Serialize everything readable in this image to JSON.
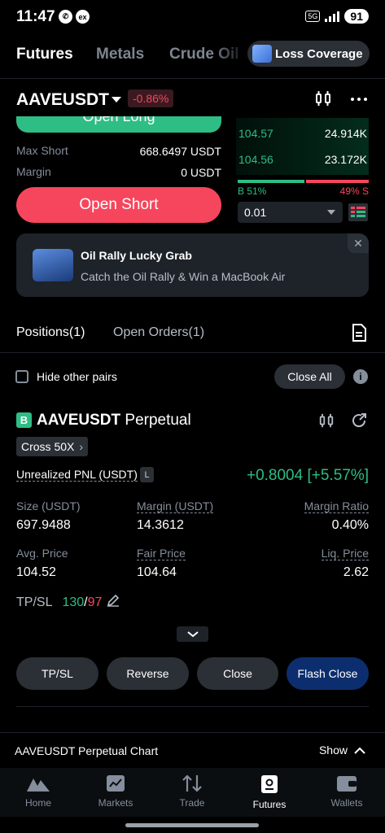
{
  "status_bar": {
    "time": "11:47",
    "network": "5G",
    "battery": "91"
  },
  "top_tabs": {
    "tabs": [
      "Futures",
      "Metals",
      "Crude Oil"
    ],
    "loss_coverage": "Loss Coverage"
  },
  "pair": {
    "symbol": "AAVEUSDT",
    "change": "-0.86%"
  },
  "trade": {
    "open_long_label": "Open Long",
    "max_short_label": "Max Short",
    "max_short_value": "668.6497 USDT",
    "margin_label": "Margin",
    "margin_value": "0 USDT",
    "open_short_label": "Open Short"
  },
  "order_book": {
    "rows": [
      {
        "price": "104.57",
        "qty": "24.914K"
      },
      {
        "price": "104.56",
        "qty": "23.172K"
      }
    ],
    "buy_label": "B 51%",
    "sell_label": "49% S",
    "buy_pct": 51,
    "precision": "0.01"
  },
  "banner": {
    "title": "Oil Rally Lucky Grab",
    "subtitle": "Catch the Oil Rally & Win a MacBook Air",
    "close": "✕"
  },
  "positions_tabs": {
    "positions": "Positions(1)",
    "open_orders": "Open Orders(1)"
  },
  "filter": {
    "hide_other_pairs": "Hide other pairs",
    "close_all": "Close All",
    "info": "i"
  },
  "position": {
    "badge": "B",
    "symbol": "AAVEUSDT",
    "type": "Perpetual",
    "cross": "Cross 50X",
    "cross_arrow": "›",
    "pnl_label": "Unrealized PNL (USDT)",
    "pnl_badge": "L",
    "pnl_value": "+0.8004 [+5.57%]",
    "size_label": "Size (USDT)",
    "size_value": "697.9488",
    "margin_label": "Margin (USDT)",
    "margin_value": "14.3612",
    "margin_ratio_label": "Margin Ratio",
    "margin_ratio_value": "0.40%",
    "avg_price_label": "Avg. Price",
    "avg_price_value": "104.52",
    "fair_price_label": "Fair Price",
    "fair_price_value": "104.64",
    "liq_price_label": "Liq. Price",
    "liq_price_value": "2.62",
    "tpsl_label": "TP/SL",
    "tp_value": "130",
    "sl_separator": "/",
    "sl_value": "97"
  },
  "actions": {
    "tpsl": "TP/SL",
    "reverse": "Reverse",
    "close": "Close",
    "flash_close": "Flash Close"
  },
  "chart_bar": {
    "title": "AAVEUSDT Perpetual Chart",
    "show": "Show"
  },
  "nav": {
    "items": [
      "Home",
      "Markets",
      "Trade",
      "Futures",
      "Wallets"
    ],
    "active": "Futures"
  },
  "colors": {
    "green": "#2ebd85",
    "red": "#f6465d",
    "flash_close_bg": "#0d2e6e"
  }
}
